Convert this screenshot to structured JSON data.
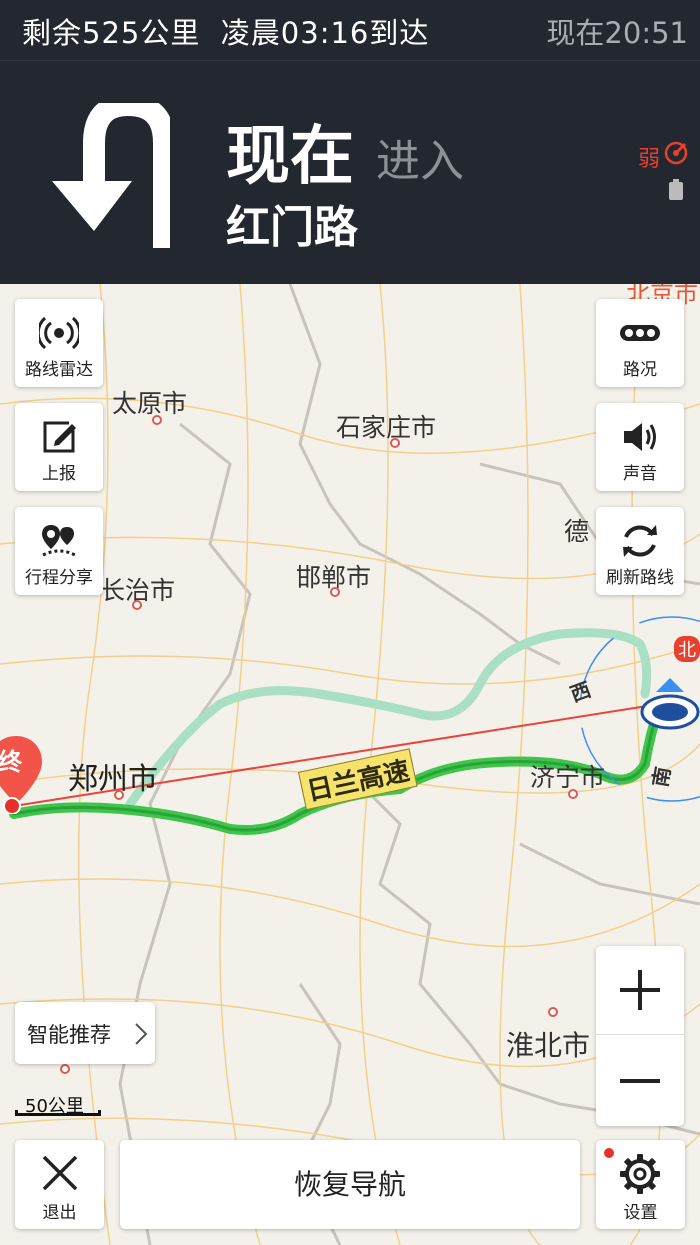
{
  "status": {
    "remaining": "剩余525公里",
    "arrival": "凌晨03:16到达",
    "now_time": "现在20:51"
  },
  "guidance": {
    "timing": "现在",
    "action": "进入",
    "road": "红门路",
    "signal_label": "弱",
    "turn_icon": "u-turn-icon"
  },
  "map": {
    "cities": [
      {
        "name": "太原市"
      },
      {
        "name": "石家庄市"
      },
      {
        "name": "长治市"
      },
      {
        "name": "邯郸市"
      },
      {
        "name": "郑州市"
      },
      {
        "name": "济宁市"
      },
      {
        "name": "淮北市"
      },
      {
        "name": "德"
      },
      {
        "name": "北京市"
      }
    ],
    "road_label": "日兰高速",
    "end_marker": "终",
    "compass": {
      "west": "西",
      "south": "南",
      "north": "北"
    },
    "scale_label": "50公里",
    "route_color": "#3fc64a",
    "alt_route_color": "#a9dfc2"
  },
  "left_buttons": [
    {
      "label": "路线雷达",
      "icon": "radar-icon"
    },
    {
      "label": "上报",
      "icon": "edit-report-icon"
    },
    {
      "label": "行程分享",
      "icon": "share-route-icon"
    }
  ],
  "right_buttons": [
    {
      "label": "路况",
      "icon": "traffic-icon"
    },
    {
      "label": "声音",
      "icon": "speaker-icon"
    },
    {
      "label": "刷新路线",
      "icon": "refresh-icon"
    }
  ],
  "smart_recommend": "智能推荐",
  "bottom": {
    "exit_label": "退出",
    "resume_label": "恢复导航",
    "settings_label": "设置"
  }
}
